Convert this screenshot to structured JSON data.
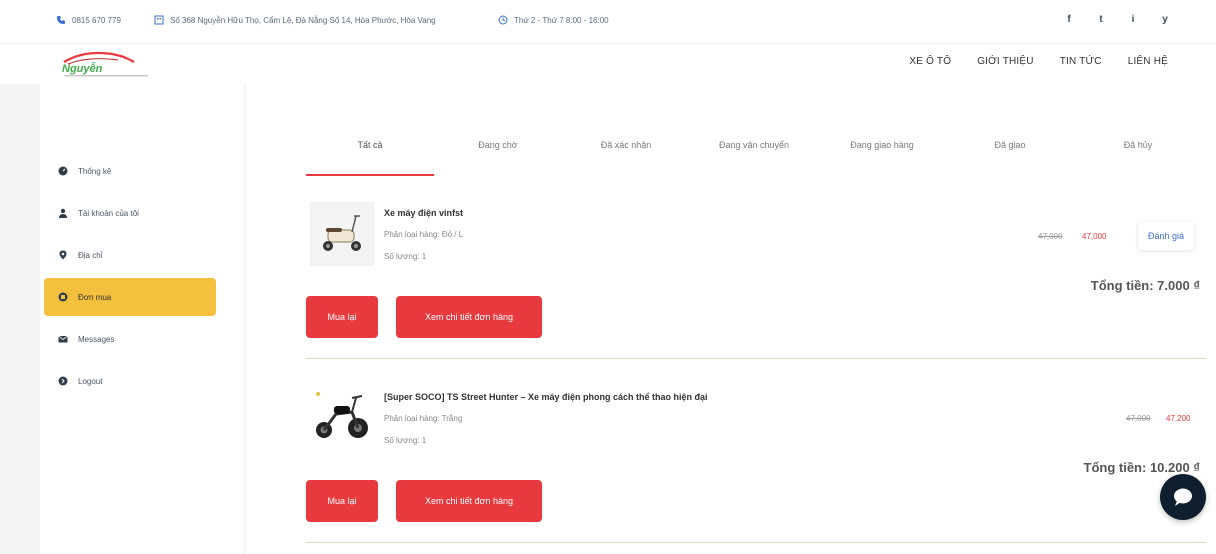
{
  "topbar": {
    "phone": "0815 670 779",
    "address": "Số 368 Nguyễn Hữu Thọ, Cẩm Lệ, Đà Nẵng Số 14, Hòa Phước, Hòa Vang",
    "hours": "Thứ 2 - Thứ 7 8:00 - 16:00",
    "social": [
      "f",
      "t",
      "i",
      "y"
    ]
  },
  "header": {
    "logo_text": "Nguyễn",
    "nav": [
      "XE Ô TÔ",
      "GIỚI THIỆU",
      "TIN TỨC",
      "LIÊN HỆ"
    ]
  },
  "sidebar": {
    "items": [
      {
        "label": "Thống kê",
        "icon": "dashboard-icon"
      },
      {
        "label": "Tài khoản của tôi",
        "icon": "user-icon"
      },
      {
        "label": "Địa chỉ",
        "icon": "location-icon"
      },
      {
        "label": "Đơn mua",
        "icon": "order-icon"
      },
      {
        "label": "Messages",
        "icon": "mail-icon"
      },
      {
        "label": "Logout",
        "icon": "logout-icon"
      }
    ]
  },
  "tabs": [
    "Tất cả",
    "Đang chờ",
    "Đã xác nhận",
    "Đang vận chuyển",
    "Đang giao hàng",
    "Đã giao",
    "Đã hủy"
  ],
  "orders": [
    {
      "name": "Xe máy điện vinfst",
      "variant": "Phân loại hàng: Đỏ / L",
      "qty": "Số lượng: 1",
      "price_old": "47,000",
      "price_new": "47,000",
      "rate_label": "Đánh giá",
      "total": "Tổng tiền: 7.000 ₫",
      "buy_again": "Mua lại",
      "view_detail": "Xem chi tiết đơn hàng"
    },
    {
      "name": "[Super SOCO] TS Street Hunter – Xe máy điện phong cách thể thao hiện đại",
      "variant": "Phân loại hàng: Trắng",
      "qty": "Số lượng: 1",
      "price_old": "47,000",
      "price_new": "47,200",
      "total": "Tổng tiền: 10.200 ₫",
      "buy_again": "Mua lại",
      "view_detail": "Xem chi tiết đơn hàng"
    }
  ],
  "colors": {
    "accent_red": "#e8393f",
    "sidebar_active": "#f4c13f",
    "divider_green": "#cfe2b2",
    "chat_bg": "#0f1e2e"
  }
}
